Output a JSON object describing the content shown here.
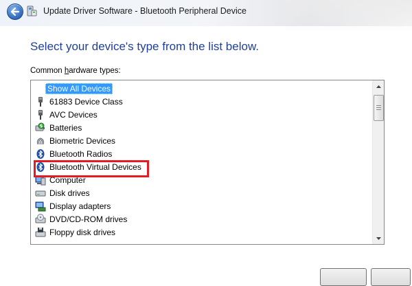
{
  "window": {
    "title": "Update Driver Software - Bluetooth Peripheral Device"
  },
  "main": {
    "heading": "Select your device's type from the list below.",
    "list_label_pre": "Common ",
    "list_label_accel": "h",
    "list_label_post": "ardware types:"
  },
  "hardware_list": {
    "items": [
      {
        "label": "Show All Devices",
        "icon": "none",
        "selected": true
      },
      {
        "label": "61883 Device Class",
        "icon": "ieee1394-plug-icon"
      },
      {
        "label": "AVC Devices",
        "icon": "ieee1394-plug-icon"
      },
      {
        "label": "Batteries",
        "icon": "battery-icon"
      },
      {
        "label": "Biometric Devices",
        "icon": "fingerprint-icon"
      },
      {
        "label": "Bluetooth Radios",
        "icon": "bluetooth-icon"
      },
      {
        "label": "Bluetooth Virtual Devices",
        "icon": "bluetooth-icon",
        "highlighted": true
      },
      {
        "label": "Computer",
        "icon": "computer-icon"
      },
      {
        "label": "Disk drives",
        "icon": "disk-drive-icon"
      },
      {
        "label": "Display adapters",
        "icon": "display-adapter-icon"
      },
      {
        "label": "DVD/CD-ROM drives",
        "icon": "dvd-drive-icon"
      },
      {
        "label": "Floppy disk drives",
        "icon": "floppy-drive-icon"
      }
    ]
  },
  "colors": {
    "heading": "#1f3f9a",
    "selection": "#3399ff",
    "highlight_box": "#e31b23"
  }
}
